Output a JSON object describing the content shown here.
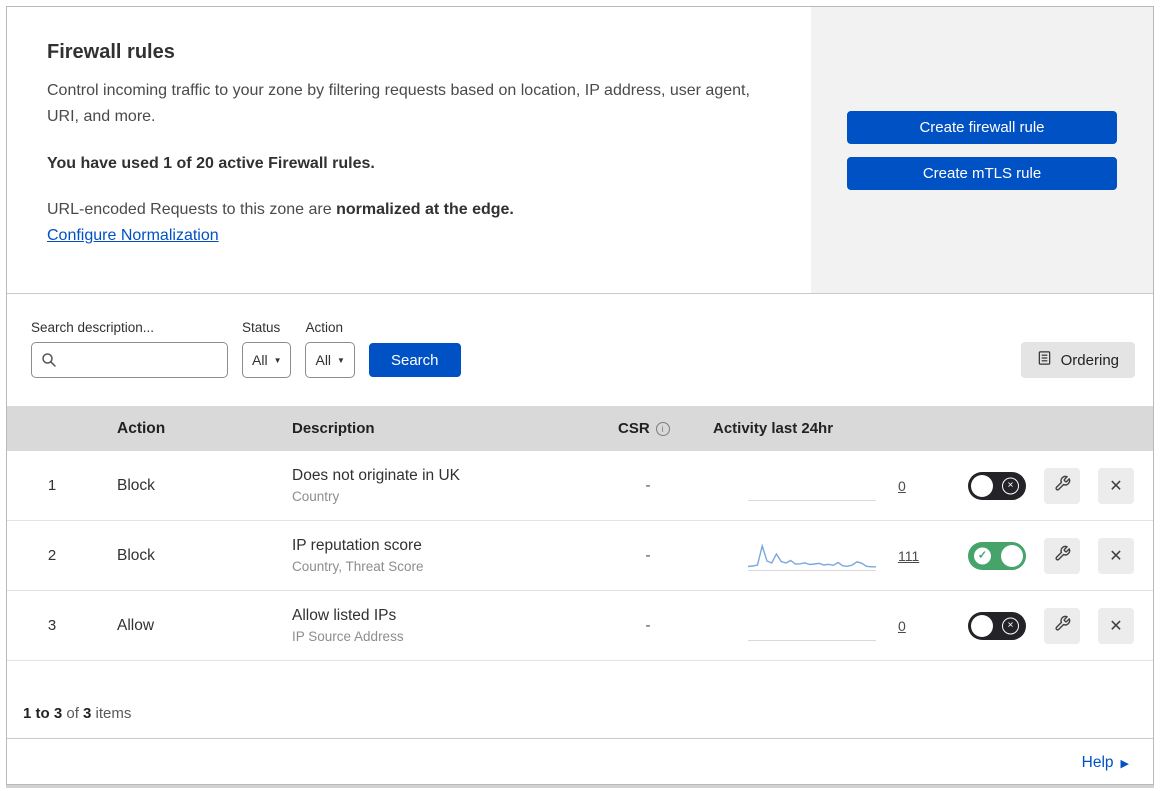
{
  "colors": {
    "primary_blue": "#0051c3",
    "toggle_on_green": "#46a46b",
    "toggle_off_dark": "#232328",
    "sparkline_blue": "#79a8dd",
    "panel_gray": "#f2f2f2",
    "table_header_gray": "#d9d9d9"
  },
  "header": {
    "title": "Firewall rules",
    "description": "Control incoming traffic to your zone by filtering requests based on location, IP address, user agent, URI, and more.",
    "usage_note": "You have used 1 of 20 active Firewall rules.",
    "normalization_text": "URL-encoded Requests to this zone are ",
    "normalization_bold": "normalized at the edge.",
    "normalization_link": "Configure Normalization",
    "create_firewall_button": "Create firewall rule",
    "create_mtls_button": "Create mTLS rule"
  },
  "filters": {
    "search_label": "Search description...",
    "search_value": "",
    "status_label": "Status",
    "status_value": "All",
    "action_label": "Action",
    "action_value": "All",
    "search_button": "Search",
    "ordering_button": "Ordering"
  },
  "table": {
    "headers": {
      "action": "Action",
      "description": "Description",
      "csr": "CSR",
      "activity": "Activity last 24hr"
    },
    "rows": [
      {
        "index": "1",
        "action": "Block",
        "description": "Does not originate in UK",
        "criteria": "Country",
        "csr": "-",
        "activity_count": "0",
        "enabled": false,
        "sparkline": []
      },
      {
        "index": "2",
        "action": "Block",
        "description": "IP reputation score",
        "criteria": "Country, Threat Score",
        "csr": "-",
        "activity_count": "111",
        "enabled": true,
        "sparkline": [
          1.0,
          1.2,
          1.6,
          9.2,
          3.2,
          2.4,
          6.0,
          3.0,
          2.4,
          3.4,
          2.0,
          2.1,
          2.5,
          1.8,
          2.0,
          2.3,
          1.6,
          1.9,
          1.5,
          2.6,
          1.3,
          1.1,
          1.6,
          2.9,
          2.3,
          1.1,
          0.9,
          0.9
        ]
      },
      {
        "index": "3",
        "action": "Allow",
        "description": "Allow listed IPs",
        "criteria": "IP Source Address",
        "csr": "-",
        "activity_count": "0",
        "enabled": false,
        "sparkline": []
      }
    ]
  },
  "footer": {
    "range": "1 to 3",
    "of_word": " of ",
    "total": "3",
    "items_word": " items",
    "help_link": "Help"
  }
}
